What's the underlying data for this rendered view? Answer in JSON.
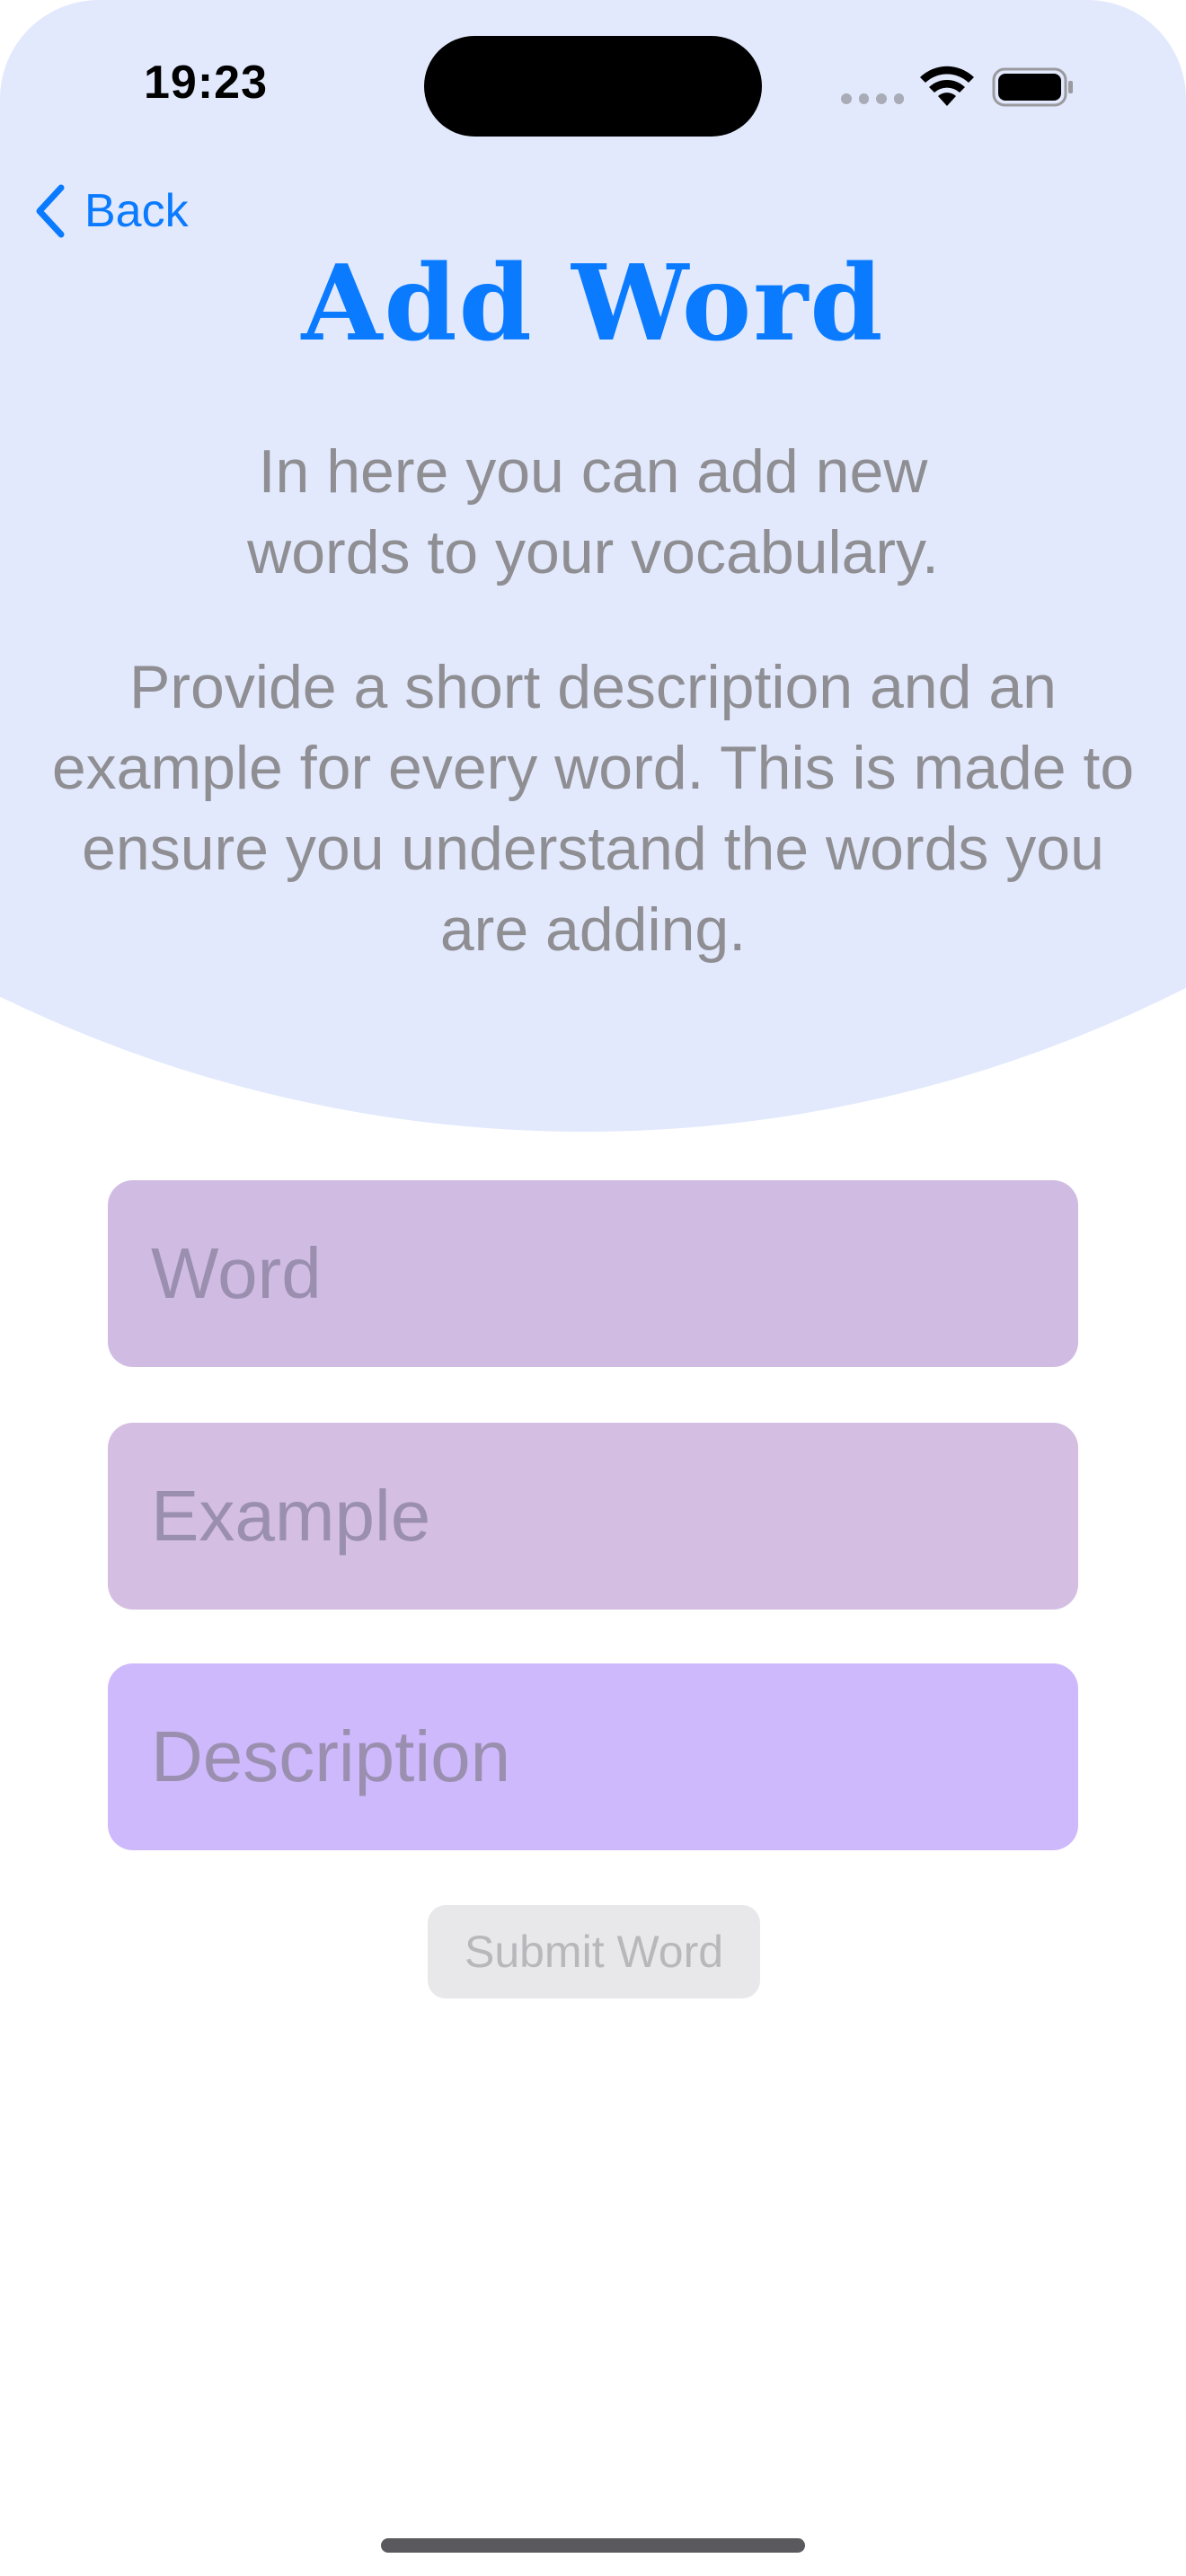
{
  "status_bar": {
    "time": "19:23",
    "signal_icon": "cellular-dots-icon",
    "wifi_icon": "wifi-icon",
    "battery_icon": "battery-full-icon"
  },
  "nav": {
    "back_label": "Back",
    "back_icon": "chevron-left-icon"
  },
  "header": {
    "title": "Add Word",
    "intro": "In here you can add new words to your vocabulary.",
    "explanation": "Provide a short description and an example for every word. This is made to ensure you understand the words you are adding."
  },
  "form": {
    "word": {
      "value": "",
      "placeholder": "Word"
    },
    "example": {
      "value": "",
      "placeholder": "Example"
    },
    "description": {
      "value": "",
      "placeholder": "Description"
    },
    "submit_label": "Submit Word"
  },
  "colors": {
    "accent": "#0a7aff",
    "header_background": "#e2e9fc",
    "word_field": "#d0bce3",
    "example_field": "#d4bfe2",
    "description_field": "#cdb9fc",
    "muted_text": "#8e8e93"
  }
}
